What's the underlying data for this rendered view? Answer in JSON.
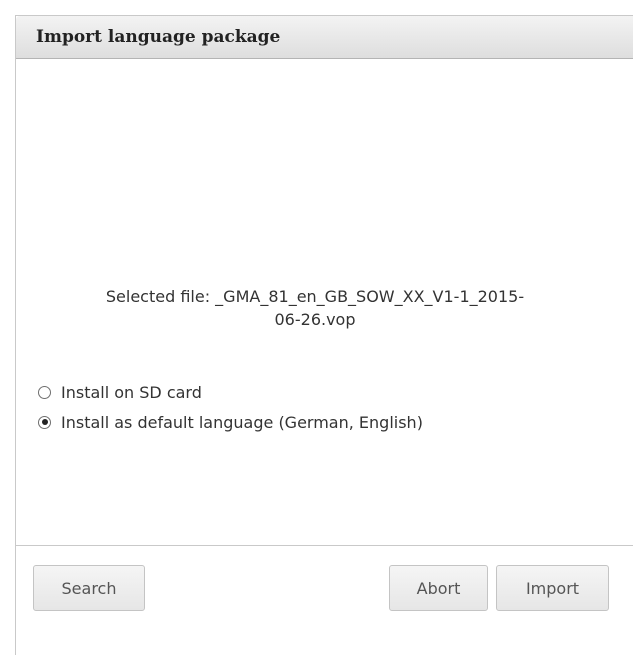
{
  "dialog": {
    "title": "Import language package",
    "selected_file_line1": "Selected file: _GMA_81_en_GB_SOW_XX_V1-1_2015-",
    "selected_file_line2": "06-26.vop",
    "options": [
      {
        "label": "Install on SD card",
        "checked": false
      },
      {
        "label": "Install as default language (German, English)",
        "checked": true
      }
    ],
    "buttons": {
      "search": "Search",
      "abort": "Abort",
      "import": "Import"
    }
  }
}
